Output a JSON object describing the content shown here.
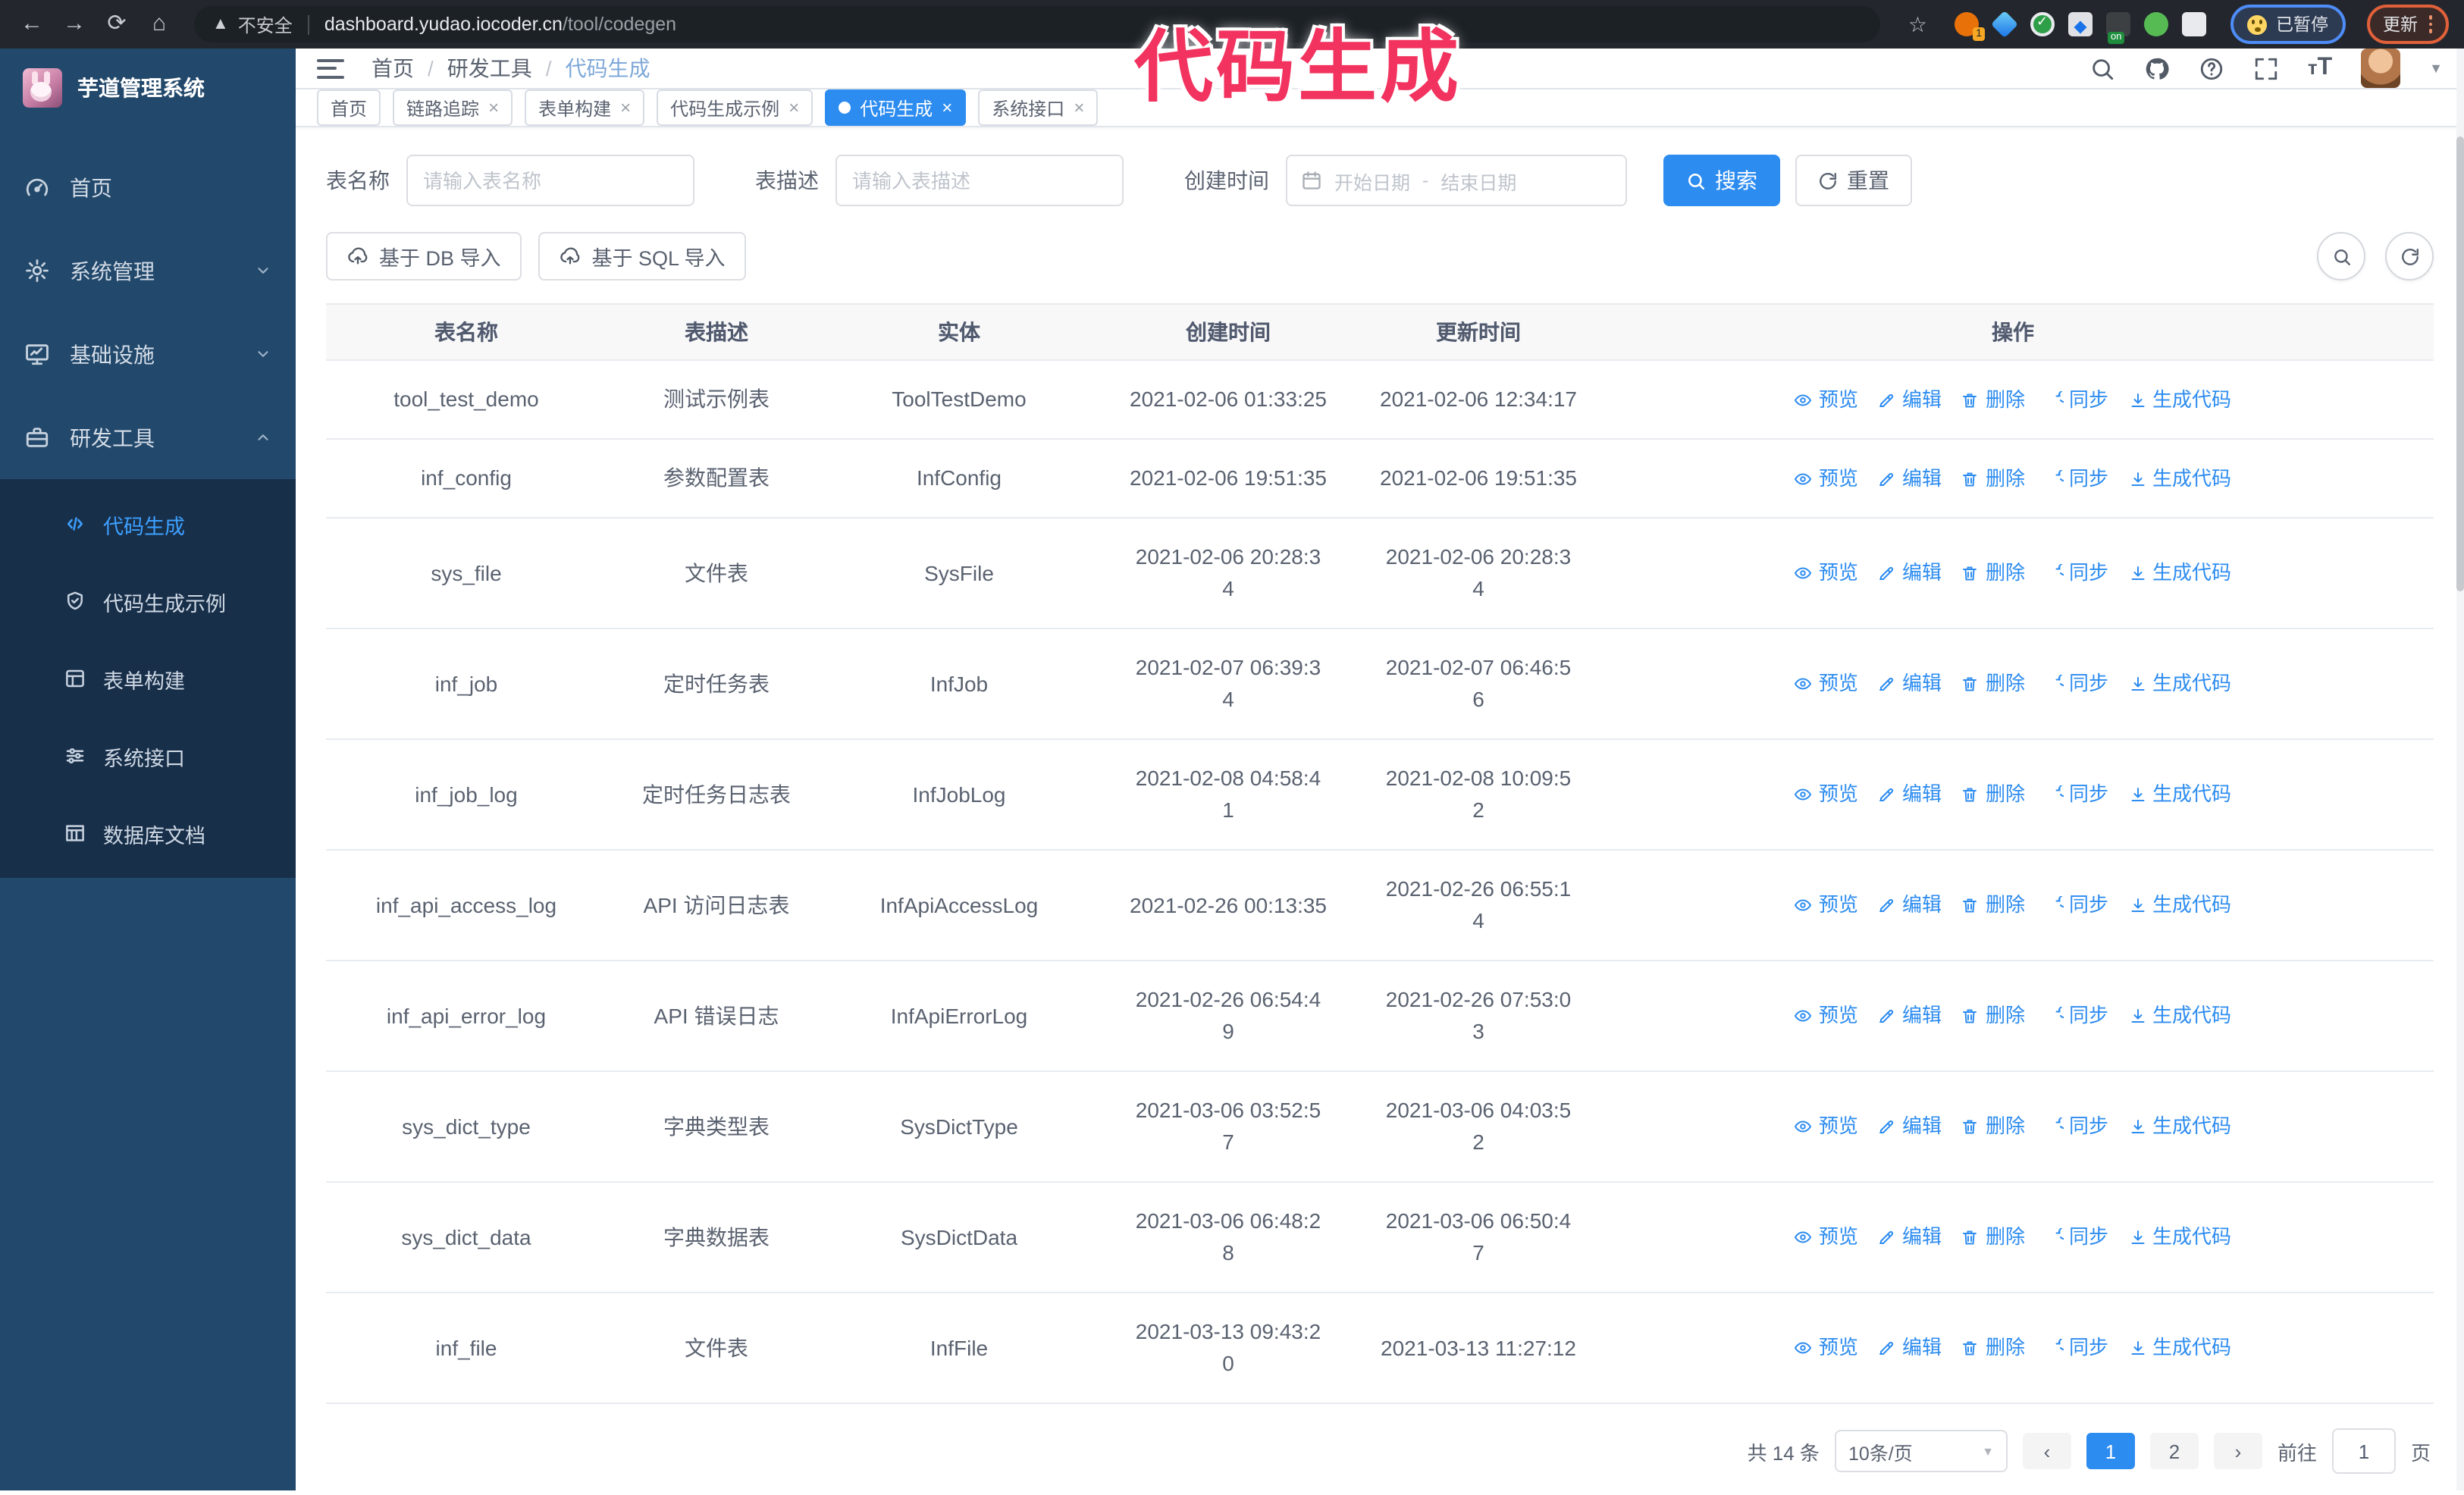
{
  "colors": {
    "primary": "#2d8cf0",
    "sidebar_bg": "#22486b",
    "submenu_bg": "#182f4a",
    "annotation": "#f2335f",
    "active_text": "#3da0ff"
  },
  "annotation": {
    "text": "代码生成"
  },
  "browser": {
    "security_warning": "不安全",
    "url_host": "dashboard.yudao.iocoder.cn",
    "url_path": "/tool/codegen",
    "extension_badge_count": "1",
    "extension_badge_on": "on",
    "paused_badge": "已暂停",
    "update_button": "更新"
  },
  "sidebar": {
    "app_title": "芋道管理系统",
    "items": [
      {
        "id": "home",
        "label": "首页",
        "icon": "dashboard-icon",
        "expandable": false,
        "expanded": false
      },
      {
        "id": "system",
        "label": "系统管理",
        "icon": "gear-icon",
        "expandable": true,
        "expanded": false
      },
      {
        "id": "infra",
        "label": "基础设施",
        "icon": "monitor-icon",
        "expandable": true,
        "expanded": false
      },
      {
        "id": "devtools",
        "label": "研发工具",
        "icon": "toolbox-icon",
        "expandable": true,
        "expanded": true
      }
    ],
    "submenu": [
      {
        "id": "codegen",
        "label": "代码生成",
        "icon": "code-icon",
        "active": true
      },
      {
        "id": "codegen-example",
        "label": "代码生成示例",
        "icon": "shield-check-icon",
        "active": false
      },
      {
        "id": "form-builder",
        "label": "表单构建",
        "icon": "form-icon",
        "active": false
      },
      {
        "id": "system-api",
        "label": "系统接口",
        "icon": "sliders-icon",
        "active": false
      },
      {
        "id": "db-doc",
        "label": "数据库文档",
        "icon": "db-doc-icon",
        "active": false
      }
    ]
  },
  "header": {
    "breadcrumb": [
      "首页",
      "研发工具",
      "代码生成"
    ]
  },
  "tabs": [
    {
      "label": "首页",
      "closable": false,
      "active": false
    },
    {
      "label": "链路追踪",
      "closable": true,
      "active": false
    },
    {
      "label": "表单构建",
      "closable": true,
      "active": false
    },
    {
      "label": "代码生成示例",
      "closable": true,
      "active": false
    },
    {
      "label": "代码生成",
      "closable": true,
      "active": true
    },
    {
      "label": "系统接口",
      "closable": true,
      "active": false
    }
  ],
  "filters": {
    "name_label": "表名称",
    "name_placeholder": "请输入表名称",
    "desc_label": "表描述",
    "desc_placeholder": "请输入表描述",
    "time_label": "创建时间",
    "start_placeholder": "开始日期",
    "range_separator": "-",
    "end_placeholder": "结束日期",
    "search_label": "搜索",
    "reset_label": "重置"
  },
  "toolbar": {
    "import_db": "基于 DB 导入",
    "import_sql": "基于 SQL 导入"
  },
  "table": {
    "columns": [
      "表名称",
      "表描述",
      "实体",
      "创建时间",
      "更新时间",
      "操作"
    ],
    "actions": [
      {
        "label": "预览",
        "icon": "eye-icon"
      },
      {
        "label": "编辑",
        "icon": "edit-icon"
      },
      {
        "label": "删除",
        "icon": "trash-icon"
      },
      {
        "label": "同步",
        "icon": "sync-icon"
      },
      {
        "label": "生成代码",
        "icon": "download-icon"
      }
    ],
    "rows": [
      {
        "name": "tool_test_demo",
        "desc": "测试示例表",
        "entity": "ToolTestDemo",
        "create_time": "2021-02-06 01:33:25",
        "update_time": "2021-02-06 12:34:17",
        "create_two_line": false,
        "update_two_line": false
      },
      {
        "name": "inf_config",
        "desc": "参数配置表",
        "entity": "InfConfig",
        "create_time": "2021-02-06 19:51:35",
        "update_time": "2021-02-06 19:51:35",
        "create_two_line": false,
        "update_two_line": false
      },
      {
        "name": "sys_file",
        "desc": "文件表",
        "entity": "SysFile",
        "create_time": "2021-02-06 20:28:34",
        "update_time": "2021-02-06 20:28:34",
        "create_two_line": true,
        "update_two_line": true
      },
      {
        "name": "inf_job",
        "desc": "定时任务表",
        "entity": "InfJob",
        "create_time": "2021-02-07 06:39:34",
        "update_time": "2021-02-07 06:46:56",
        "create_two_line": true,
        "update_two_line": true
      },
      {
        "name": "inf_job_log",
        "desc": "定时任务日志表",
        "entity": "InfJobLog",
        "create_time": "2021-02-08 04:58:41",
        "update_time": "2021-02-08 10:09:52",
        "create_two_line": true,
        "update_two_line": true
      },
      {
        "name": "inf_api_access_log",
        "desc": "API 访问日志表",
        "entity": "InfApiAccessLog",
        "create_time": "2021-02-26 00:13:35",
        "update_time": "2021-02-26 06:55:14",
        "create_two_line": false,
        "update_two_line": true
      },
      {
        "name": "inf_api_error_log",
        "desc": "API 错误日志",
        "entity": "InfApiErrorLog",
        "create_time": "2021-02-26 06:54:49",
        "update_time": "2021-02-26 07:53:03",
        "create_two_line": true,
        "update_two_line": true
      },
      {
        "name": "sys_dict_type",
        "desc": "字典类型表",
        "entity": "SysDictType",
        "create_time": "2021-03-06 03:52:57",
        "update_time": "2021-03-06 04:03:52",
        "create_two_line": true,
        "update_two_line": true
      },
      {
        "name": "sys_dict_data",
        "desc": "字典数据表",
        "entity": "SysDictData",
        "create_time": "2021-03-06 06:48:28",
        "update_time": "2021-03-06 06:50:47",
        "create_two_line": true,
        "update_two_line": true
      },
      {
        "name": "inf_file",
        "desc": "文件表",
        "entity": "InfFile",
        "create_time": "2021-03-13 09:43:20",
        "update_time": "2021-03-13 11:27:12",
        "create_two_line": true,
        "update_two_line": false
      }
    ]
  },
  "pagination": {
    "total": "共 14 条",
    "page_size": "10条/页",
    "pages": [
      "1",
      "2"
    ],
    "active_page": "1",
    "goto_label": "前往",
    "goto_value": "1",
    "page_suffix": "页"
  }
}
